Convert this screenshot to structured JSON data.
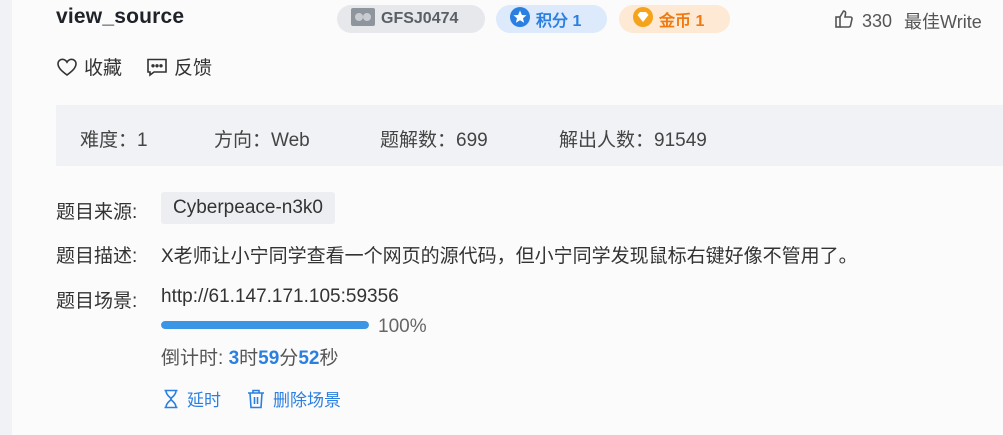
{
  "challenge": {
    "title": "view_source",
    "id_badge": "GFSJ0474",
    "score_badge": "积分 1",
    "gold_badge": "金币 1",
    "likes": "330",
    "best_writeup": "最佳Write"
  },
  "actions": {
    "favorite": "收藏",
    "feedback": "反馈"
  },
  "stats": {
    "difficulty": "难度：1",
    "direction": "方向：Web",
    "solves": "题解数：699",
    "solvers": "解出人数：91549"
  },
  "details": {
    "source_label": "题目来源:",
    "source_value": "Cyberpeace-n3k0",
    "desc_label": "题目描述:",
    "desc_value": "X老师让小宁同学查看一个网页的源代码，但小宁同学发现鼠标右键好像不管用了。",
    "scene_label": "题目场景:",
    "scene_url": "http://61.147.171.105:59356",
    "progress_text": "100%",
    "progress_value": 1.0,
    "countdown_label": "倒计时: ",
    "hours": "3",
    "hours_unit": "时",
    "minutes": "59",
    "minutes_unit": "分",
    "seconds": "52",
    "seconds_unit": "秒"
  },
  "scene_actions": {
    "extend": "延时",
    "delete": "删除场景"
  },
  "colors": {
    "accent": "#2b7fe0",
    "gold": "#f07a10",
    "progress": "#3b97e6"
  }
}
